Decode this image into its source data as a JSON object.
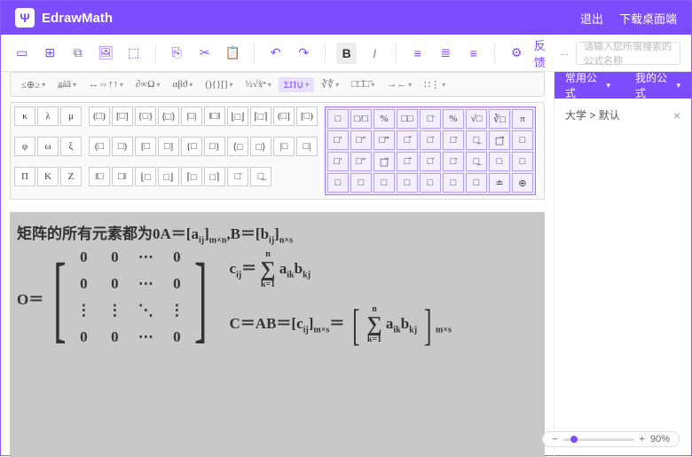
{
  "header": {
    "brand": "EdrawMath",
    "logo_glyph": "Ψ",
    "exit": "退出",
    "download": "下载桌面端"
  },
  "toolbar": {
    "feedback": "反馈",
    "search_placeholder": "请输入您所需搜索的公式名称",
    "bold": "B",
    "italic": "I"
  },
  "categories": [
    "≤⊕≥",
    "a̲ȧa̅",
    "↔⇔↑↑",
    "∂∞Ω",
    "αβϑ",
    "(){}[]",
    "½√x̄ⁿ",
    "ΣΠ∪",
    "∛∜",
    "□̈□̂□̃",
    "→←",
    "∷⋮"
  ],
  "category_active_index": 7,
  "grid_greek": [
    "κ",
    "λ",
    "μ",
    "φ",
    "ω",
    "ξ",
    "Π",
    "K",
    "Z"
  ],
  "grid_brackets": [
    "(□)",
    "[□]",
    "{□}",
    "⟨□⟩",
    "|□|",
    "‖□‖",
    "⌊□⌋",
    "⌈□⌉",
    "(□]",
    "[□)",
    "(□",
    "□)",
    "[□",
    "□]",
    "{□",
    "□}",
    "⟨□",
    "□⟩",
    "|□",
    "□|",
    "‖□",
    "□‖",
    "⌊□",
    "□⌋",
    "⌈□",
    "□⌉",
    "□̄",
    "□̲"
  ],
  "grid_highlight": [
    "□",
    "□/□",
    "%",
    "□□",
    "□̈",
    "%",
    "√□",
    "∛□",
    "π",
    "□′",
    "□″",
    "□‴",
    "□̂",
    "□̇",
    "□̄",
    "□̲",
    "□⃗",
    "□",
    "□′",
    "□″",
    "□⃗",
    "□̂",
    "□̇",
    "□̄",
    "□̲",
    "□",
    "□",
    "□",
    "□",
    "□",
    "□",
    "□",
    "□",
    "□",
    "≐",
    "⊕"
  ],
  "tabs": {
    "common": "常用公式",
    "mine": "我的公式"
  },
  "breadcrumb": {
    "cat1": "大学",
    "sep": ">",
    "cat2": "默认"
  },
  "editor": {
    "line1_prefix": "矩阵的所有元素都为0A＝[a",
    "line1_sub1": "ij",
    "line1_mid1": "]",
    "line1_sub2": "m×n",
    "line1_mid2": ",B＝[b",
    "line1_sub3": "ij",
    "line1_mid3": "]",
    "line1_sub4": "n×s",
    "O_eq": "O＝",
    "matrix": [
      "0",
      "0",
      "⋯",
      "0",
      "0",
      "0",
      "⋯",
      "0",
      "⋮",
      "⋮",
      "⋱",
      "⋮",
      "0",
      "0",
      "⋯",
      "0"
    ],
    "sum1_lhs": "c",
    "sum1_sub": "ij",
    "sum1_eq": "＝",
    "sum_top": "n",
    "sum_bottom": "k=1",
    "sum1_rhs1": "a",
    "sum1_rhs2": "b",
    "sum1_rhs1_sub": "ik",
    "sum1_rhs2_sub": "kj",
    "line3_a": "C＝AB＝[c",
    "line3_sub1": "ij",
    "line3_b": "]",
    "line3_sub2": "m×s",
    "line3_c": "＝",
    "line3_rhs1": "a",
    "line3_rhs1_sub": "ik",
    "line3_rhs2": "b",
    "line3_rhs2_sub": "kj",
    "line3_sub3": "m×s"
  },
  "zoom": {
    "minus": "−",
    "plus": "+",
    "value": "90%"
  }
}
